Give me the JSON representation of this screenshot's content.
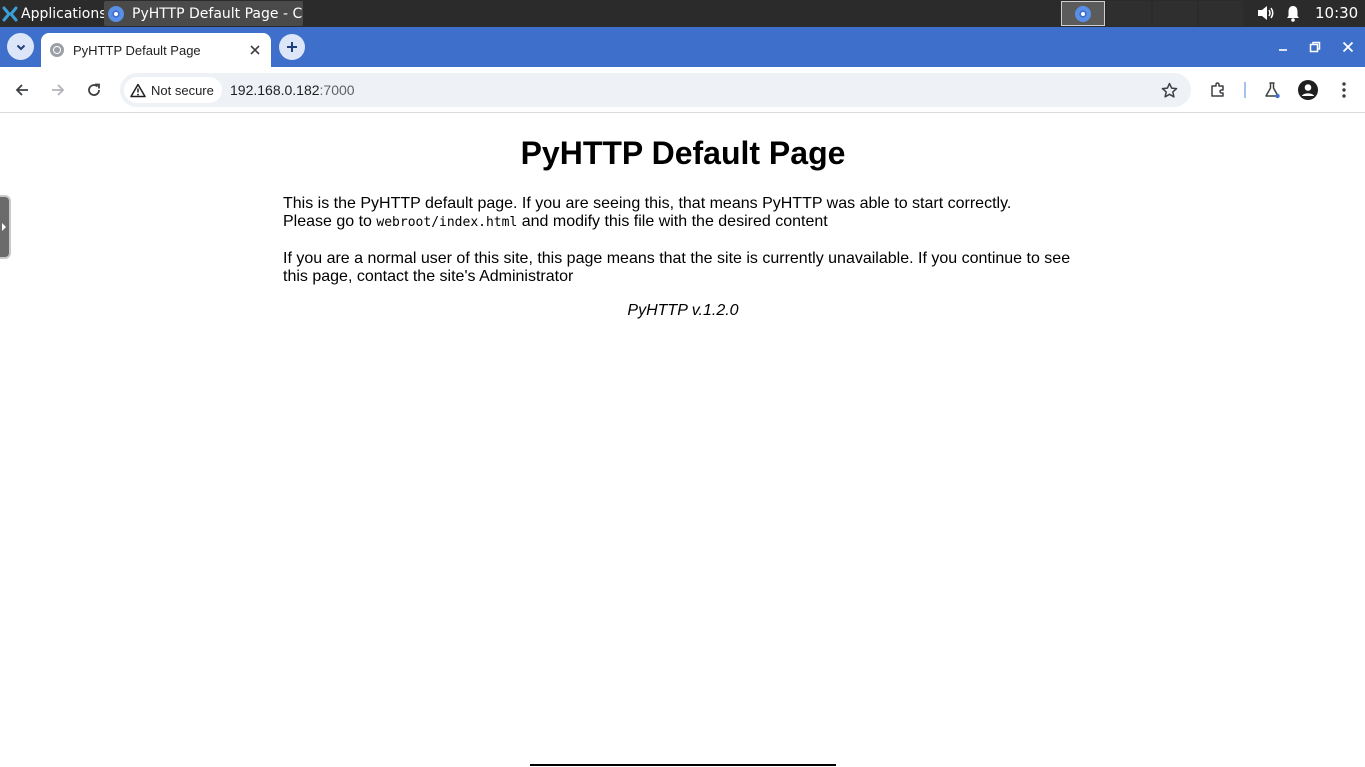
{
  "taskbar": {
    "apps_label": "Applications",
    "active_task": "PyHTTP Default Page - Ch...",
    "clock": "10:30"
  },
  "browser": {
    "tab_title": "PyHTTP Default Page",
    "security_label": "Not secure",
    "url_host": "192.168.0.182",
    "url_port": ":7000",
    "accent_color": "#3d6fcb"
  },
  "page": {
    "title": "PyHTTP Default Page",
    "p1_line1": "This is the PyHTTP default page. If you are seeing this, that means PyHTTP was able to start correctly.",
    "p1_prefix": "Please go to ",
    "p1_code": "webroot/index.html",
    "p1_suffix": " and modify this file with the desired content",
    "p2": "If you are a normal user of this site, this page means that the site is currently unavailable. If you continue to see this page, contact the site's Administrator",
    "version": "PyHTTP v.1.2.0"
  }
}
